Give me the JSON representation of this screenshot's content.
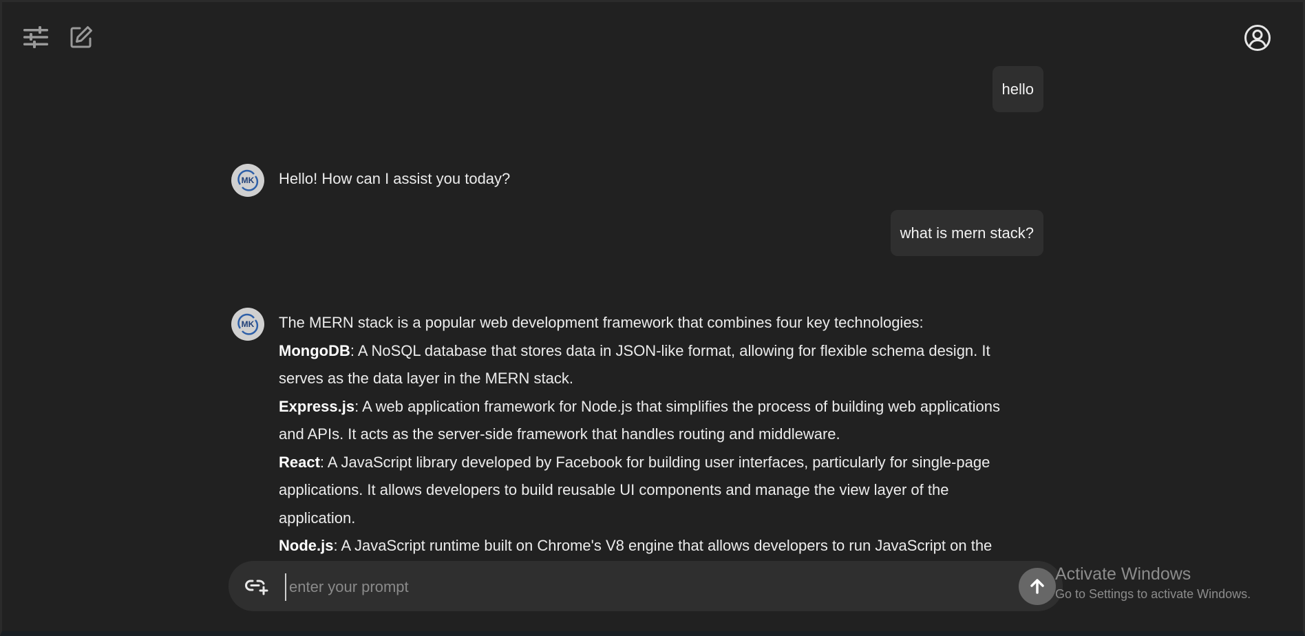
{
  "header": {
    "settings_icon": "sliders-icon",
    "new_chat_icon": "edit-icon",
    "profile_icon": "user-circle-icon"
  },
  "messages": [
    {
      "role": "user",
      "text": "hello"
    },
    {
      "role": "assistant",
      "avatar": "MK",
      "text": "Hello! How can I assist you today?"
    },
    {
      "role": "user",
      "text": "what is mern stack?"
    },
    {
      "role": "assistant",
      "avatar": "MK",
      "intro": "The MERN stack is a popular web development framework that combines four key technologies:",
      "items": [
        {
          "term": "MongoDB",
          "desc": ": A NoSQL database that stores data in JSON-like format, allowing for flexible schema design. It serves as the data layer in the MERN stack."
        },
        {
          "term": "Express.js",
          "desc": ": A web application framework for Node.js that simplifies the process of building web applications and APIs. It acts as the server-side framework that handles routing and middleware."
        },
        {
          "term": "React",
          "desc": ": A JavaScript library developed by Facebook for building user interfaces, particularly for single-page applications. It allows developers to build reusable UI components and manage the view layer of the application."
        },
        {
          "term": "Node.js",
          "desc": ": A JavaScript runtime built on Chrome's V8 engine that allows developers to run JavaScript on the"
        }
      ]
    }
  ],
  "composer": {
    "placeholder": "enter your prompt",
    "attach_icon": "link-plus-icon",
    "send_icon": "arrow-up-icon"
  },
  "watermark": {
    "title": "Activate Windows",
    "subtitle": "Go to Settings to activate Windows."
  },
  "colors": {
    "background": "#212121",
    "bubble": "#2f2f2f",
    "send_button": "#676767"
  }
}
